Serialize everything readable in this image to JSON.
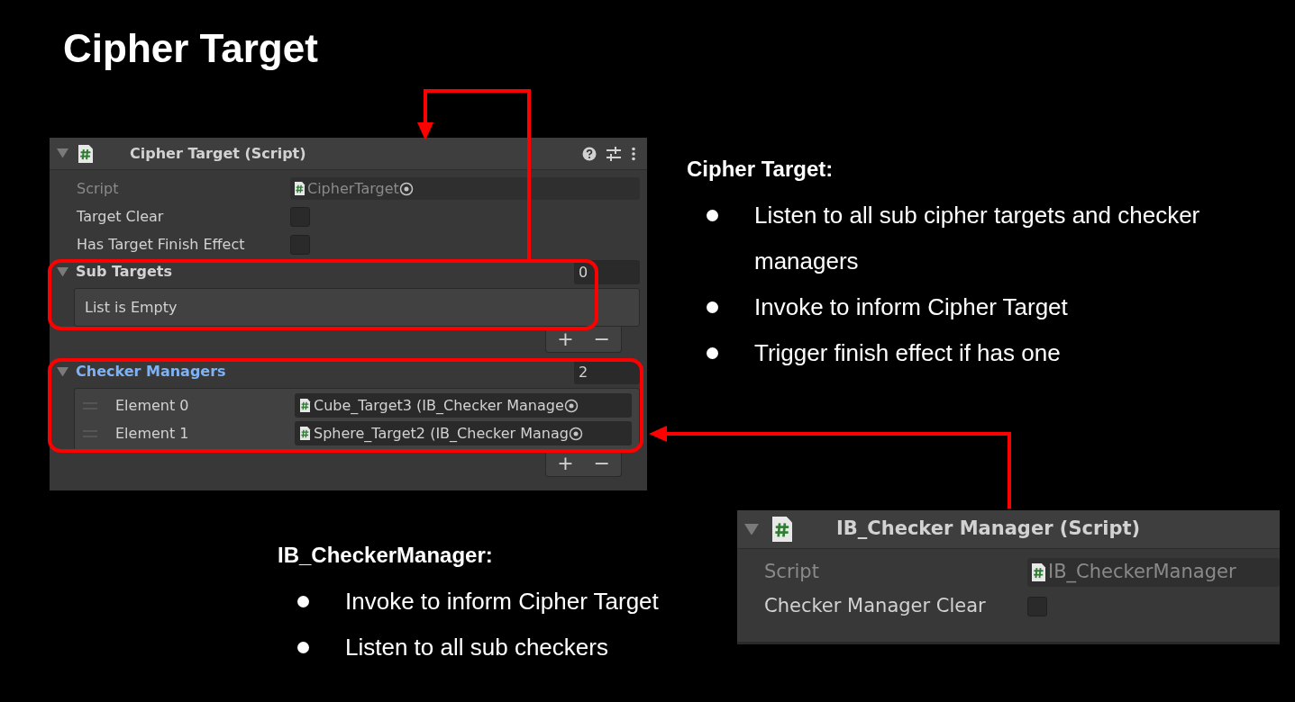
{
  "title": "Cipher Target",
  "cipher_component": {
    "title": "Cipher Target (Script)",
    "fields": [
      {
        "kind": "object",
        "label": "Script",
        "value": "CipherTarget",
        "disabled": true
      },
      {
        "kind": "toggle",
        "label": "Target Clear",
        "checked": false
      },
      {
        "kind": "toggle",
        "label": "Has Target Finish Effect",
        "checked": false
      }
    ],
    "lists": [
      {
        "label": "Sub Targets",
        "count": "0",
        "selected": false,
        "empty_text": "List is Empty",
        "add_button": "+",
        "remove_button": "−"
      },
      {
        "label": "Checker Managers",
        "count": "2",
        "selected": true,
        "elements": [
          {
            "label": "Element 0",
            "value": "Cube_Target3 (IB_Checker Manage"
          },
          {
            "label": "Element 1",
            "value": "Sphere_Target2 (IB_Checker Manag"
          }
        ],
        "add_button": "+",
        "remove_button": "−"
      }
    ]
  },
  "notes": [
    {
      "heading": "Cipher Target:",
      "bullets": [
        "Listen to all sub cipher targets and checker managers",
        "Invoke to inform Cipher Target",
        "Trigger finish effect if has one"
      ]
    },
    {
      "heading": "IB_CheckerManager:",
      "bullets": [
        "Invoke to inform Cipher Target",
        "Listen to all sub checkers"
      ]
    }
  ],
  "checker_component": {
    "title": "IB_Checker Manager (Script)",
    "fields": [
      {
        "kind": "object",
        "label": "Script",
        "value": "IB_CheckerManager",
        "disabled": true
      },
      {
        "kind": "toggle",
        "label": "Checker Manager Clear",
        "checked": false
      }
    ]
  }
}
